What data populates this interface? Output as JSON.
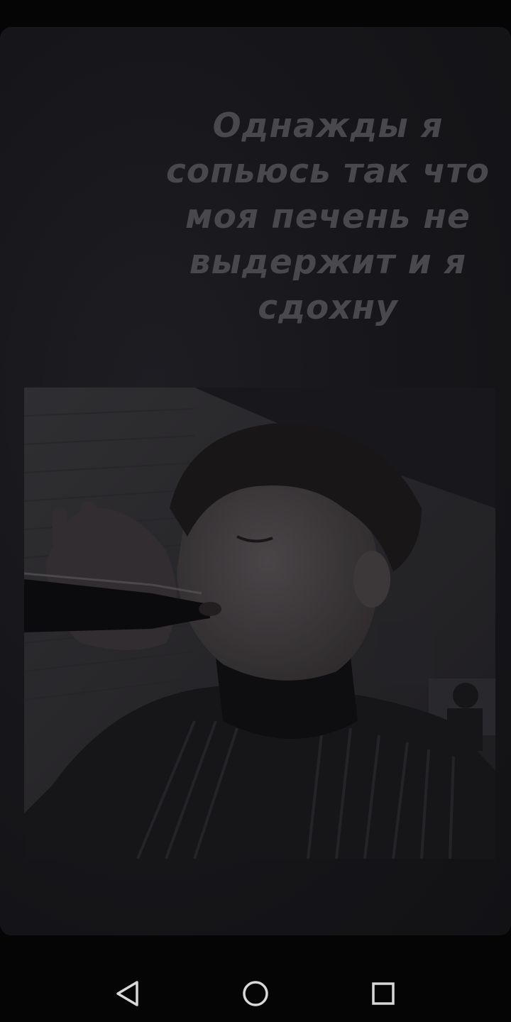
{
  "story": {
    "caption": "Однажды я сопьюсь так что моя печень не выдержит и я сдохну",
    "photo_icon": "photo"
  },
  "nav_bar": {
    "back_icon": "triangle-back-icon",
    "home_icon": "circle-home-icon",
    "recents_icon": "square-recents-icon"
  },
  "colors": {
    "background": "#050506",
    "card": "#17171b",
    "caption_text": "#49484d",
    "nav_icon": "#d8d8d8"
  }
}
